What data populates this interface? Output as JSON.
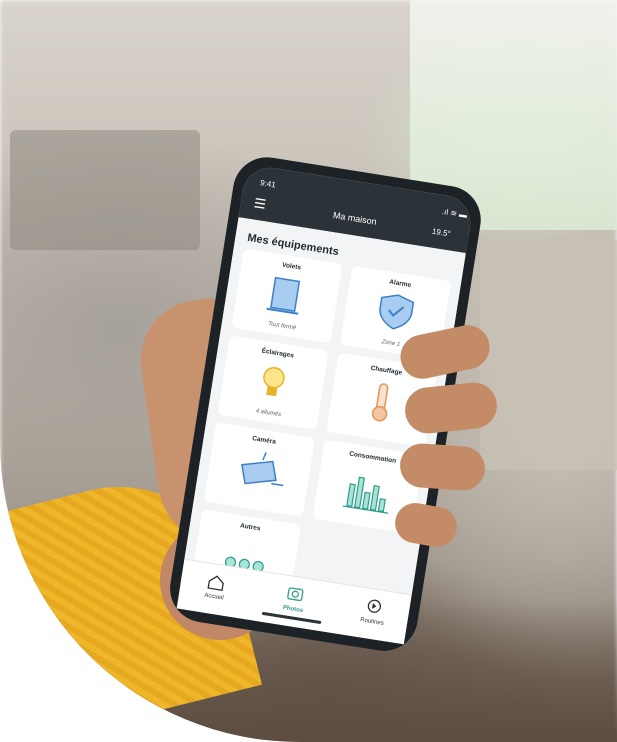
{
  "status": {
    "time": "9:41",
    "temp": "19.5°"
  },
  "header": {
    "title": "Ma maison"
  },
  "section": {
    "title": "Mes équipements"
  },
  "cards": [
    {
      "title": "Volets",
      "status": "Tout fermé",
      "icon": "shutter-icon"
    },
    {
      "title": "Alarme",
      "status": "Zone 1",
      "icon": "shield-check-icon"
    },
    {
      "title": "Éclairages",
      "status": "4 allumés",
      "icon": "bulb-icon"
    },
    {
      "title": "Chauffage",
      "status": "",
      "icon": "thermometer-icon"
    },
    {
      "title": "Caméra",
      "status": "",
      "icon": "camera-icon"
    },
    {
      "title": "Consommation",
      "status": "",
      "icon": "bar-chart-icon"
    },
    {
      "title": "Autres",
      "status": "",
      "icon": "dots-icon"
    }
  ],
  "nav": [
    {
      "label": "Accueil",
      "icon": "home-icon"
    },
    {
      "label": "Photos",
      "icon": "camera-icon"
    },
    {
      "label": "Routines",
      "icon": "routine-icon"
    }
  ],
  "colors": {
    "accent": "#2f9d8a",
    "icon_blue": "#3d7fc8",
    "bulb": "#f2c53c",
    "thermo": "#e0955a",
    "header_bg": "#2b3238"
  }
}
